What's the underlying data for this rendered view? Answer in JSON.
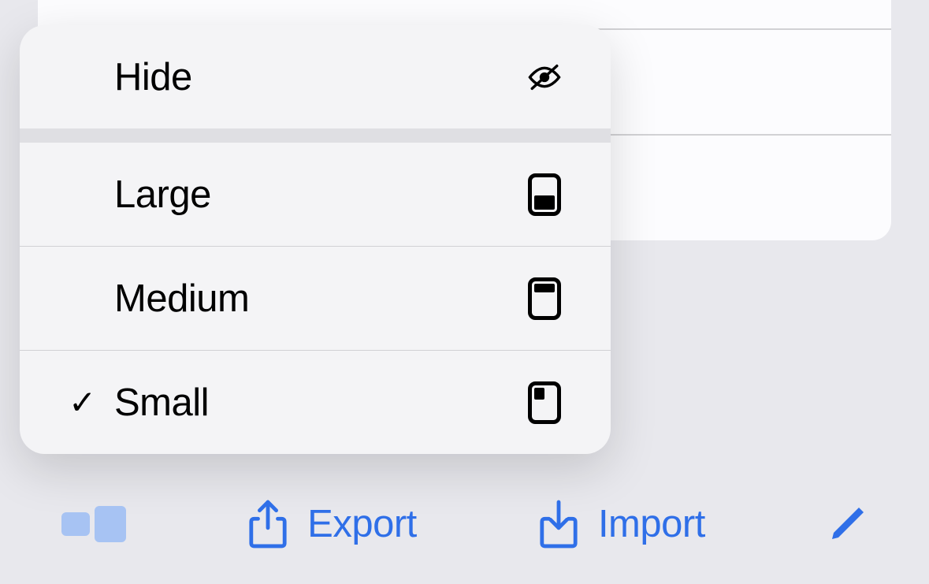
{
  "menu": {
    "items": [
      {
        "label": "Hide",
        "icon": "eye-slash-icon",
        "selected": false
      },
      {
        "label": "Large",
        "icon": "thumbnail-large-icon",
        "selected": false
      },
      {
        "label": "Medium",
        "icon": "thumbnail-medium-icon",
        "selected": false
      },
      {
        "label": "Small",
        "icon": "thumbnail-small-icon",
        "selected": true
      }
    ]
  },
  "toolbar": {
    "layout_button": "Layout",
    "export_label": "Export",
    "import_label": "Import",
    "edit_button": "Edit"
  }
}
